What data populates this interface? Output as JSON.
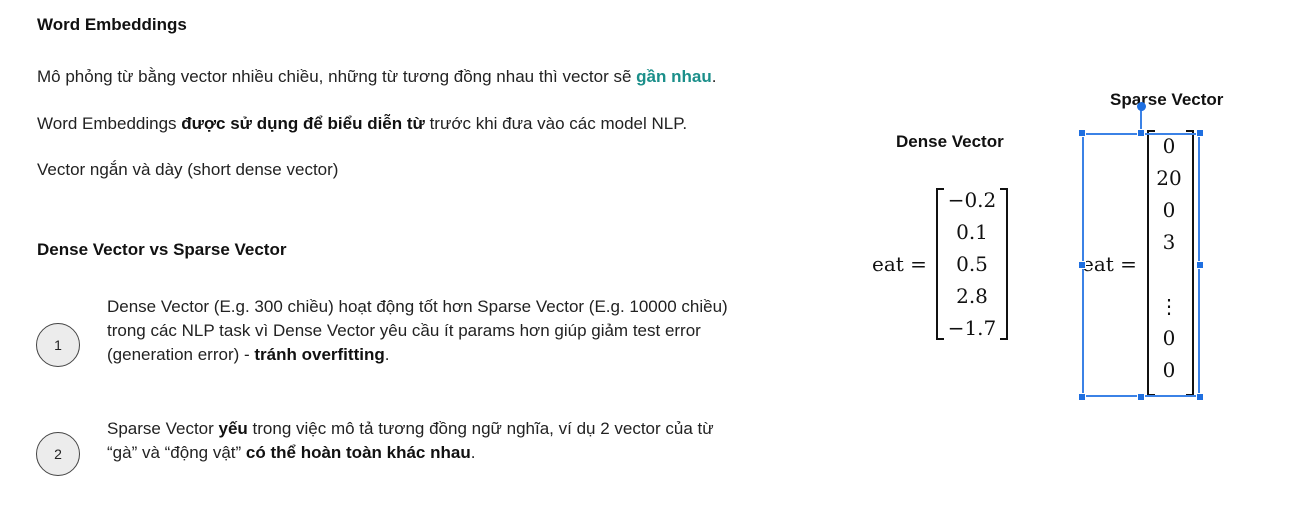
{
  "section1": {
    "title": "Word Embeddings",
    "line1_prefix": "Mô phỏng từ bằng vector nhiều chiều, những từ tương đồng nhau thì vector sẽ ",
    "line1_highlight": "gần nhau",
    "line1_suffix": ".",
    "line2_prefix": "Word Embeddings ",
    "line2_bold": "được sử dụng để biểu diễn từ",
    "line2_suffix": " trước khi đưa vào các model NLP.",
    "line3": "Vector ngắn và dày (short dense vector)"
  },
  "section2": {
    "title": "Dense Vector vs Sparse Vector",
    "items": [
      {
        "number": "1",
        "text_prefix": "Dense Vector (E.g. 300 chiều) hoạt động tốt hơn Sparse Vector (E.g. 10000 chiều) trong các NLP task vì Dense Vector yêu cầu ít params hơn giúp giảm test error (generation error) - ",
        "text_bold": "tránh overfitting",
        "text_suffix": "."
      },
      {
        "number": "2",
        "text_prefix": "Sparse Vector ",
        "text_bold": "yếu",
        "text_mid": " trong việc mô tả tương đồng ngữ nghĩa, ví dụ 2 vector của từ “gà” và “động vật” ",
        "text_bold2": "có thể hoàn toàn khác nhau",
        "text_suffix": "."
      }
    ]
  },
  "dense": {
    "title": "Dense Vector",
    "lhs": "eat =",
    "values": [
      "−0.2",
      "0.1",
      "0.5",
      "2.8",
      "−1.7"
    ]
  },
  "sparse": {
    "title": "Sparse Vector",
    "lhs": "eat =",
    "values": [
      "0",
      "20",
      "0",
      "3",
      "",
      "⋮",
      "0",
      "0"
    ]
  },
  "colors": {
    "accent": "#1b8f8a",
    "selection": "#3b82e6"
  }
}
